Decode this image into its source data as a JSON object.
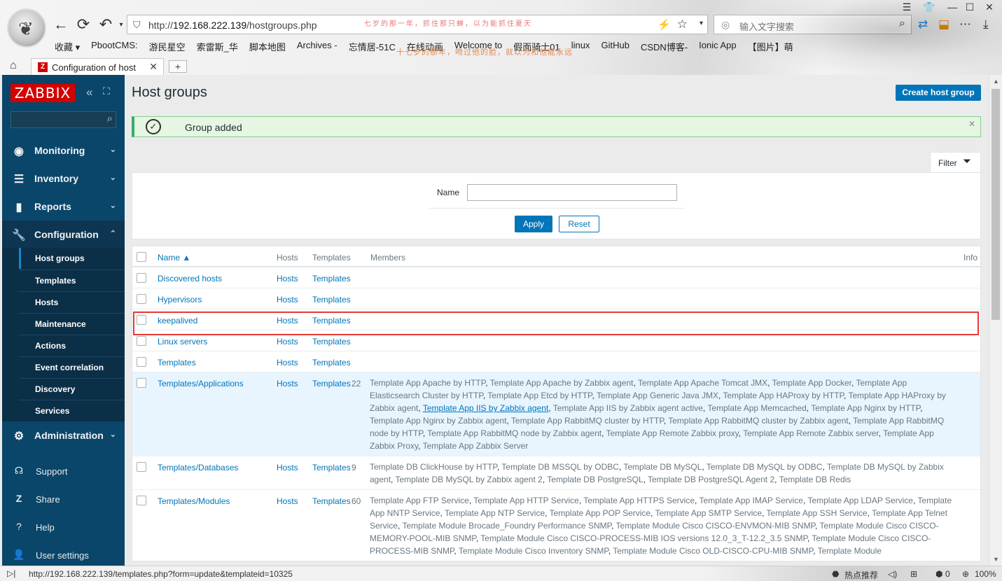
{
  "browser": {
    "url_prefix": "http://",
    "url_host": "192.168.222.139",
    "url_path": "/hostgroups.php",
    "search_placeholder": "输入文字搜索",
    "slogan_top": "七岁的那一年，抓住那只蝉，以为能抓住夏天",
    "slogan_bottom": "十七岁的那年，吻过他的脸，就以为和他能永远",
    "bookmarks": [
      "收藏 ▾",
      "PbootCMS:",
      "游民星空",
      "索雷斯_华",
      "脚本地图",
      "Archives -",
      "忘情居-51C",
      "在线动画",
      "Welcome to",
      "假面骑士01",
      "linux",
      "GitHub",
      "CSDN博客-",
      "Ionic App",
      "【图片】萌"
    ],
    "tab_title": "Configuration of host",
    "status_url": "http://192.168.222.139/templates.php?form=update&templateid=10325",
    "status_right": [
      "热点推荐",
      "0",
      "100%"
    ]
  },
  "sidebar": {
    "logo": "ZABBIX",
    "menus": [
      {
        "label": "Monitoring",
        "icon": "◉"
      },
      {
        "label": "Inventory",
        "icon": "☰"
      },
      {
        "label": "Reports",
        "icon": "▮"
      },
      {
        "label": "Configuration",
        "icon": "🔧"
      }
    ],
    "submenu": [
      "Host groups",
      "Templates",
      "Hosts",
      "Maintenance",
      "Actions",
      "Event correlation",
      "Discovery",
      "Services"
    ],
    "administration": "Administration",
    "bottom": [
      "Support",
      "Share",
      "Help",
      "User settings"
    ]
  },
  "page": {
    "title": "Host groups",
    "create_button": "Create host group",
    "message": "Group added",
    "filter_tab": "Filter",
    "filter_name_label": "Name",
    "filter_name_value": "",
    "apply": "Apply",
    "reset": "Reset"
  },
  "table": {
    "headers": {
      "name": "Name ▲",
      "hosts": "Hosts",
      "templates": "Templates",
      "members": "Members",
      "info": "Info"
    },
    "rows": [
      {
        "name": "Discovered hosts",
        "hosts": "Hosts",
        "templates": "Templates"
      },
      {
        "name": "Hypervisors",
        "hosts": "Hosts",
        "templates": "Templates"
      },
      {
        "name": "keepalived",
        "hosts": "Hosts",
        "templates": "Templates"
      },
      {
        "name": "Linux servers",
        "hosts": "Hosts",
        "templates": "Templates"
      },
      {
        "name": "Templates",
        "hosts": "Hosts",
        "templates": "Templates"
      },
      {
        "name": "Templates/Applications",
        "hosts": "Hosts",
        "templates": "Templates",
        "count": "22",
        "members": [
          "Template App Apache by HTTP",
          "Template App Apache by Zabbix agent",
          "Template App Apache Tomcat JMX",
          "Template App Docker",
          "Template App Elasticsearch Cluster by HTTP",
          "Template App Etcd by HTTP",
          "Template App Generic Java JMX",
          "Template App HAProxy by HTTP",
          "Template App HAProxy by Zabbix agent",
          "Template App IIS by Zabbix agent",
          "Template App IIS by Zabbix agent active",
          "Template App Memcached",
          "Template App Nginx by HTTP",
          "Template App Nginx by Zabbix agent",
          "Template App RabbitMQ cluster by HTTP",
          "Template App RabbitMQ cluster by Zabbix agent",
          "Template App RabbitMQ node by HTTP",
          "Template App RabbitMQ node by Zabbix agent",
          "Template App Remote Zabbix proxy",
          "Template App Remote Zabbix server",
          "Template App Zabbix Proxy",
          "Template App Zabbix Server"
        ]
      },
      {
        "name": "Templates/Databases",
        "hosts": "Hosts",
        "templates": "Templates",
        "count": "9",
        "members": [
          "Template DB ClickHouse by HTTP",
          "Template DB MSSQL by ODBC",
          "Template DB MySQL",
          "Template DB MySQL by ODBC",
          "Template DB MySQL by Zabbix agent",
          "Template DB MySQL by Zabbix agent 2",
          "Template DB PostgreSQL",
          "Template DB PostgreSQL Agent 2",
          "Template DB Redis"
        ]
      },
      {
        "name": "Templates/Modules",
        "hosts": "Hosts",
        "templates": "Templates",
        "count": "60",
        "members": [
          "Template App FTP Service",
          "Template App HTTP Service",
          "Template App HTTPS Service",
          "Template App IMAP Service",
          "Template App LDAP Service",
          "Template App NNTP Service",
          "Template App NTP Service",
          "Template App POP Service",
          "Template App SMTP Service",
          "Template App SSH Service",
          "Template App Telnet Service",
          "Template Module Brocade_Foundry Performance SNMP",
          "Template Module Cisco CISCO-ENVMON-MIB SNMP",
          "Template Module Cisco CISCO-MEMORY-POOL-MIB SNMP",
          "Template Module Cisco CISCO-PROCESS-MIB IOS versions 12.0_3_T-12.2_3.5 SNMP",
          "Template Module Cisco CISCO-PROCESS-MIB SNMP",
          "Template Module Cisco Inventory SNMP",
          "Template Module Cisco OLD-CISCO-CPU-MIB SNMP",
          "Template Module"
        ]
      }
    ]
  }
}
